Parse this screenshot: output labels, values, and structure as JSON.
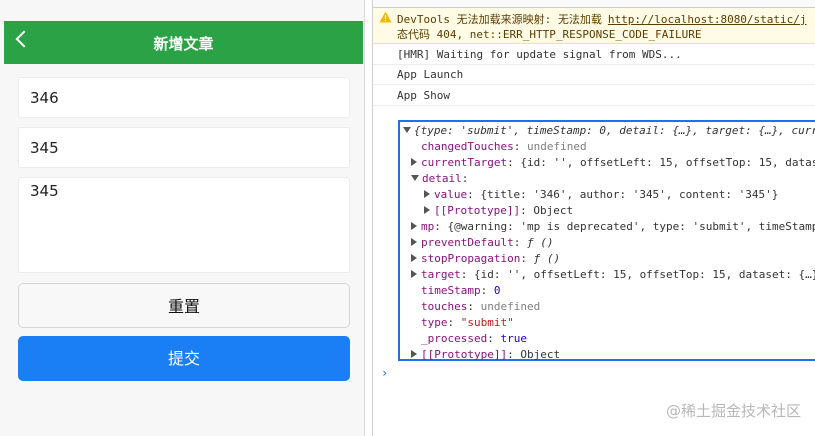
{
  "phone": {
    "nav_title": "新增文章",
    "fields": {
      "title": "346",
      "author": "345",
      "content": "345"
    },
    "reset_label": "重置",
    "submit_label": "提交",
    "colors": {
      "nav": "#2ba245",
      "submit": "#1a7ff5"
    }
  },
  "console": {
    "warning": {
      "line1": "DevTools 无法加载来源映射: 无法加载",
      "link": "http://localhost:8080/static/j",
      "line2": "态代码 404, net::ERR_HTTP_RESPONSE_CODE_FAILURE"
    },
    "messages": [
      "[HMR] Waiting for update signal from WDS...",
      "App Launch",
      "App Show"
    ],
    "object": {
      "summary": "{type: 'submit', timeStamp: 0, detail: {…}, target: {…}, curre",
      "lines": [
        {
          "key": "changedTouches",
          "value": "undefined"
        },
        {
          "key": "currentTarget",
          "value": "{id: '', offsetLeft: 15, offsetTop: 15, datas"
        },
        {
          "key": "detail",
          "value": ""
        },
        {
          "key": "value",
          "value": "{title: '346', author: '345', content: '345'}"
        },
        {
          "key": "[[Prototype]]",
          "value": "Object"
        },
        {
          "key": "mp",
          "value": "{@warning: 'mp is deprecated', type: 'submit', timeStamp"
        },
        {
          "key": "preventDefault",
          "value": "ƒ ()"
        },
        {
          "key": "stopPropagation",
          "value": "ƒ ()"
        },
        {
          "key": "target",
          "value": "{id: '', offsetLeft: 15, offsetTop: 15, dataset: {…}"
        },
        {
          "key": "timeStamp",
          "value": "0"
        },
        {
          "key": "touches",
          "value": "undefined"
        },
        {
          "key": "type",
          "value": "\"submit\""
        },
        {
          "key": "_processed",
          "value": "true"
        },
        {
          "key": "[[Prototype]]",
          "value": "Object"
        }
      ]
    },
    "prompt": "›"
  },
  "watermark": "@稀土掘金技术社区"
}
